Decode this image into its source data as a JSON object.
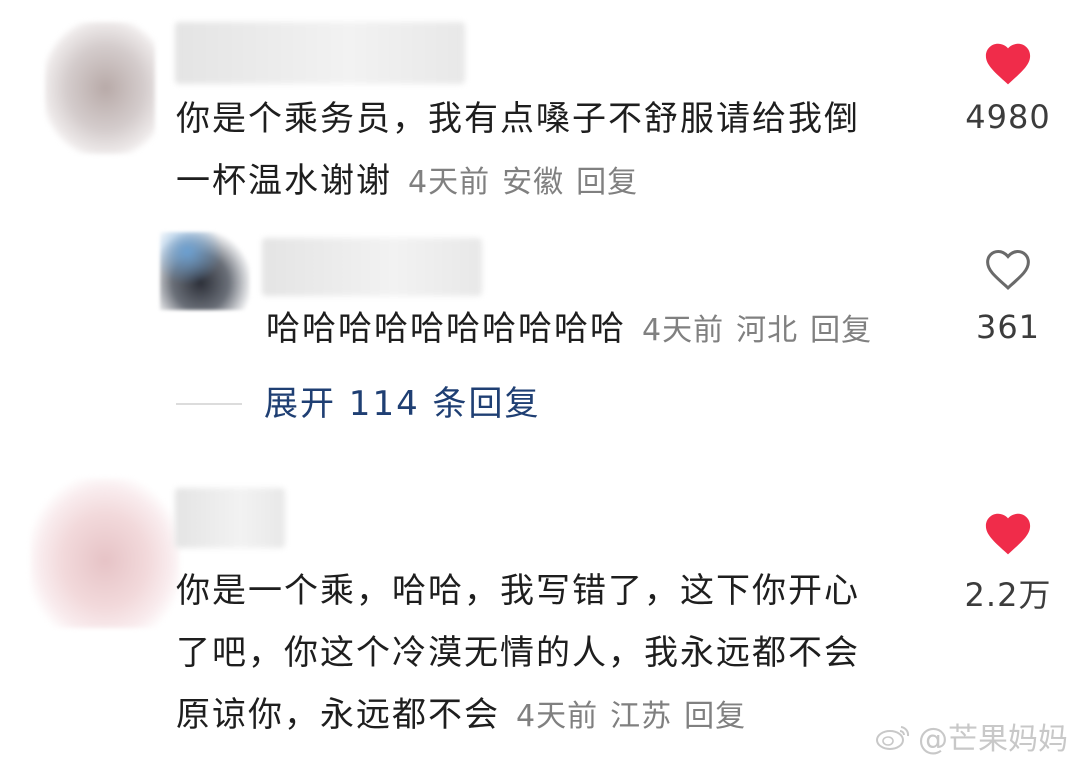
{
  "comments": [
    {
      "text_line1": "你是个乘务员，我有点嗓子不舒服请给我倒",
      "text_line2": "一杯温水谢谢",
      "time": "4天前",
      "location": "安徽",
      "reply_label": "回复",
      "likes": "4980",
      "liked": true
    },
    {
      "text_line1": "哈哈哈哈哈哈哈哈哈哈",
      "time": "4天前",
      "location": "河北",
      "reply_label": "回复",
      "likes": "361",
      "liked": false
    },
    {
      "text_line1": "你是一个乘，哈哈，我写错了，这下你开心",
      "text_line2": "了吧，你这个冷漠无情的人，我永远都不会",
      "text_line3": "原谅你，永远都不会",
      "time": "4天前",
      "location": "江苏",
      "reply_label": "回复",
      "likes": "2.2万",
      "liked": true
    }
  ],
  "expand_replies": "展开 114 条回复",
  "watermark": "@芒果妈妈",
  "icons": {
    "liked": "heart-filled-icon",
    "unliked": "heart-outline-icon",
    "watermark_logo": "weibo-logo-icon"
  },
  "colors": {
    "like_red": "#f02c4a",
    "link_blue": "#1f3f73",
    "meta_gray": "#808080"
  }
}
